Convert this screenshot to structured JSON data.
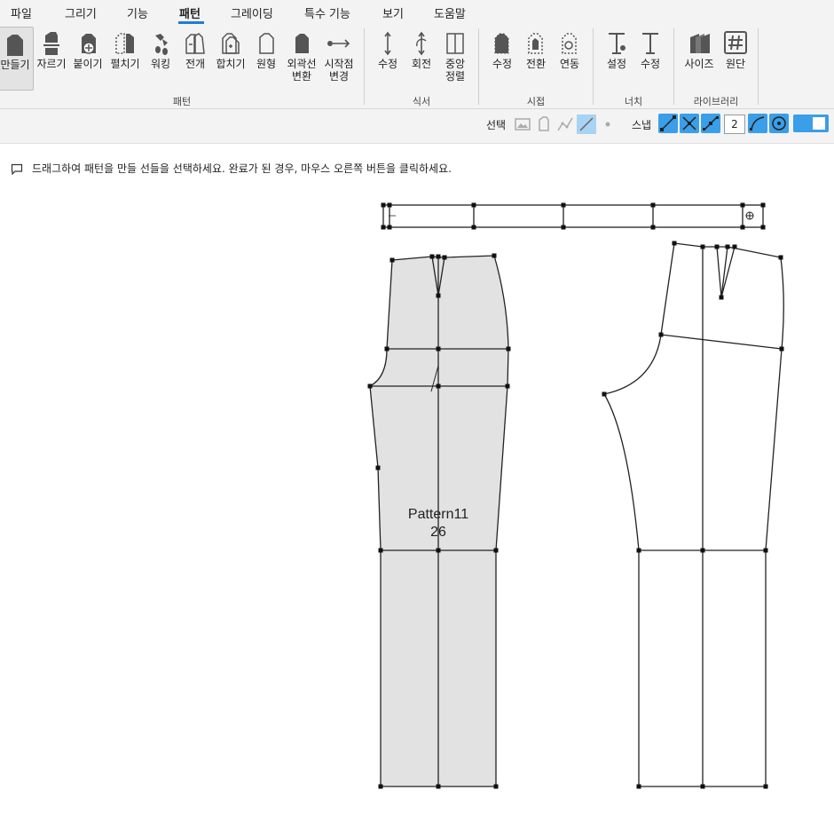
{
  "menu": {
    "items": [
      {
        "label": "파일"
      },
      {
        "label": "그리기"
      },
      {
        "label": "기능"
      },
      {
        "label": "패턴"
      },
      {
        "label": "그레이딩"
      },
      {
        "label": "특수 기능"
      },
      {
        "label": "보기"
      },
      {
        "label": "도움말"
      }
    ],
    "active_index": 3
  },
  "ribbon": {
    "pattern_group": {
      "label": "패턴",
      "buttons": [
        {
          "line1": "만들기",
          "line2": "",
          "icon": "create-pattern-icon"
        },
        {
          "line1": "자르기",
          "line2": "",
          "icon": "cut-pattern-icon"
        },
        {
          "line1": "붙이기",
          "line2": "",
          "icon": "join-pattern-icon"
        },
        {
          "line1": "펼치기",
          "line2": "",
          "icon": "unfold-pattern-icon"
        },
        {
          "line1": "워킹",
          "line2": "",
          "icon": "walking-icon"
        },
        {
          "line1": "전개",
          "line2": "",
          "icon": "develop-pattern-icon"
        },
        {
          "line1": "합치기",
          "line2": "",
          "icon": "merge-pattern-icon"
        },
        {
          "line1": "원형",
          "line2": "",
          "icon": "original-pattern-icon"
        },
        {
          "line1": "외곽선",
          "line2": "변환",
          "icon": "outline-convert-icon"
        },
        {
          "line1": "시작점",
          "line2": "변경",
          "icon": "start-point-icon"
        }
      ]
    },
    "grain_group": {
      "label": "식서",
      "buttons": [
        {
          "line1": "수정",
          "line2": "",
          "icon": "grain-edit-icon"
        },
        {
          "line1": "회전",
          "line2": "",
          "icon": "grain-rotate-icon"
        },
        {
          "line1": "중앙",
          "line2": "정렬",
          "icon": "grain-center-icon"
        }
      ]
    },
    "seam_group": {
      "label": "시접",
      "buttons": [
        {
          "line1": "수정",
          "line2": "",
          "icon": "seam-edit-icon"
        },
        {
          "line1": "전환",
          "line2": "",
          "icon": "seam-toggle-icon"
        },
        {
          "line1": "연동",
          "line2": "",
          "icon": "seam-link-icon"
        }
      ]
    },
    "notch_group": {
      "label": "너치",
      "buttons": [
        {
          "line1": "설정",
          "line2": "",
          "icon": "notch-settings-icon"
        },
        {
          "line1": "수정",
          "line2": "",
          "icon": "notch-edit-icon"
        }
      ]
    },
    "library_group": {
      "label": "라이브러리",
      "buttons": [
        {
          "line1": "사이즈",
          "line2": "",
          "icon": "size-library-icon"
        },
        {
          "line1": "원단",
          "line2": "",
          "icon": "fabric-library-icon"
        }
      ]
    }
  },
  "toolbar2": {
    "select_label": "선택",
    "snap_label": "스냅",
    "snap_value": "2"
  },
  "hint": {
    "text": "드래그하여 패턴을 만들 선들을 선택하세요. 완료가 된 경우, 마우스 오른쪽 버튼을 클릭하세요."
  },
  "canvas": {
    "pattern_name": "Pattern11",
    "pattern_size": "26",
    "fill_color": "#e2e2e2"
  }
}
